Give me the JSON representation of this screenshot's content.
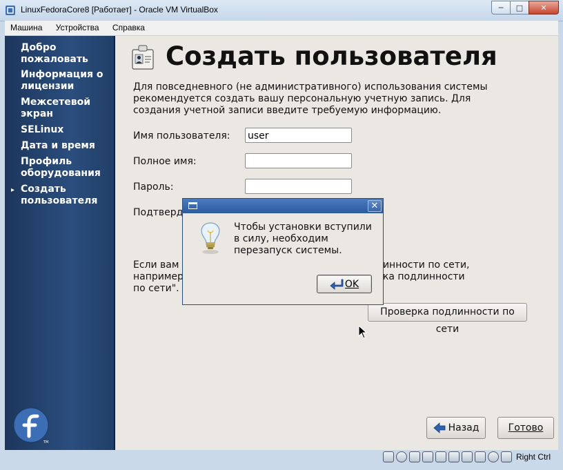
{
  "window": {
    "title": "LinuxFedoraCore8 [Работает] - Oracle VM VirtualBox",
    "minimize_icon": "minimize-icon",
    "maximize_icon": "maximize-icon",
    "close_icon": "close-icon"
  },
  "menubar": {
    "items": [
      "Машина",
      "Устройства",
      "Справка"
    ]
  },
  "sidebar": {
    "items": [
      {
        "label": "Добро пожаловать"
      },
      {
        "label": "Информация о лицензии"
      },
      {
        "label": "Межсетевой экран"
      },
      {
        "label": "SELinux"
      },
      {
        "label": "Дата и время"
      },
      {
        "label": "Профиль оборудования"
      },
      {
        "label": "Создать пользователя",
        "current": true
      }
    ]
  },
  "page": {
    "title": "Создать пользователя",
    "intro": "Для повседневного (не административного) использования системы рекомендуется создать вашу персональную учетную запись. Для создания учетной записи введите требуемую информацию.",
    "fields": {
      "username": {
        "label": "Имя пользователя:",
        "value": "user"
      },
      "fullname": {
        "label": "Полное имя:",
        "value": ""
      },
      "password": {
        "label": "Пароль:",
        "value": ""
      },
      "confirm": {
        "label": "Подтверд"
      }
    },
    "network_text_left": "Если вам н\nнапример\nпо сети\".",
    "network_text_right": "линности по сети,\nрка подлинности",
    "network_button": "Проверка подлинности по сети",
    "back_button": "Назад",
    "finish_button": "Готово"
  },
  "dialog": {
    "message": "Чтобы установки вступили в силу, необходим перезапуск системы.",
    "ok_label": "OK",
    "icon": "lightbulb-icon"
  },
  "statusbar": {
    "host_key": "Right Ctrl"
  },
  "colors": {
    "sidebar": "#2b4e7e",
    "dialog_title": "#3866ab",
    "background": "#ebe7e3"
  }
}
